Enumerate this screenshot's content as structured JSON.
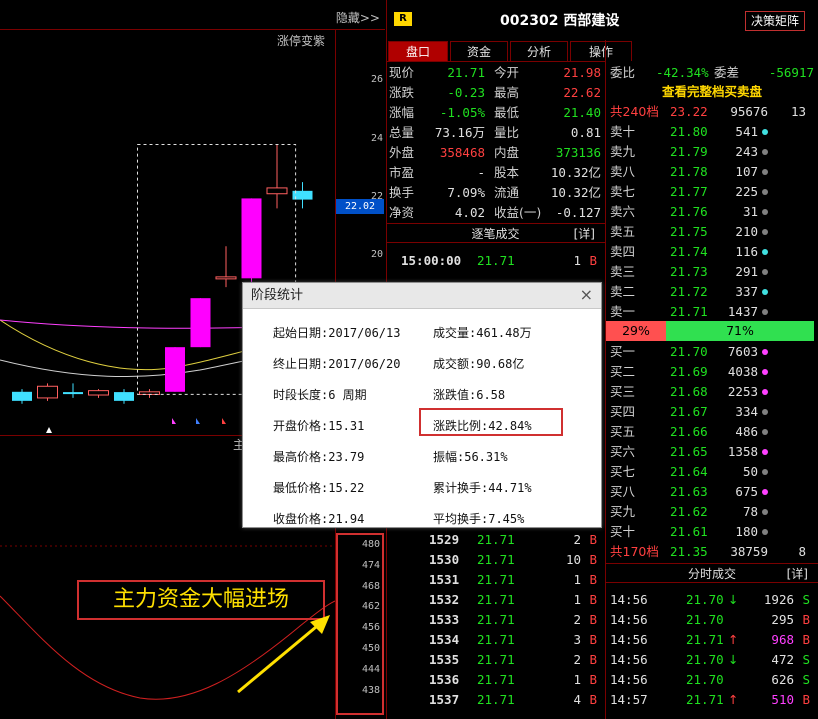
{
  "chart": {
    "hide_label": "隐藏>>",
    "indicator_label": "涨停变紫",
    "current_price_tag": "22.02",
    "y_ticks": [
      "26",
      "24",
      "22",
      "20"
    ],
    "vol_ticks": [
      "480",
      "474",
      "468",
      "462",
      "456",
      "450",
      "444",
      "438"
    ],
    "banner": "主力资金大幅进场",
    "sub_label": "主",
    "candles": [
      {
        "o": 15.31,
        "c": 15.0,
        "h": 15.4,
        "l": 14.9
      },
      {
        "o": 15.1,
        "c": 15.5,
        "h": 15.6,
        "l": 15.0
      },
      {
        "o": 15.3,
        "c": 15.25,
        "h": 15.6,
        "l": 15.1
      },
      {
        "o": 15.2,
        "c": 15.35,
        "h": 15.4,
        "l": 15.1
      },
      {
        "o": 15.3,
        "c": 15.0,
        "h": 15.4,
        "l": 14.9
      },
      {
        "o": 15.22,
        "c": 15.31,
        "h": 15.4,
        "l": 15.1
      },
      {
        "o": 15.31,
        "c": 16.84,
        "h": 16.84,
        "l": 15.31
      },
      {
        "o": 16.84,
        "c": 18.52,
        "h": 18.52,
        "l": 16.84
      },
      {
        "o": 19.25,
        "c": 19.25,
        "h": 20.3,
        "l": 18.9
      },
      {
        "o": 19.2,
        "c": 21.94,
        "h": 21.94,
        "l": 19.0
      },
      {
        "o": 22.1,
        "c": 22.3,
        "h": 23.79,
        "l": 21.6
      },
      {
        "o": 22.2,
        "c": 21.9,
        "h": 22.5,
        "l": 21.6
      }
    ]
  },
  "header": {
    "badge": "R",
    "title": "002302 西部建设",
    "decision_button": "决策矩阵"
  },
  "tabs": [
    "盘口",
    "资金",
    "分析",
    "操作"
  ],
  "quote": {
    "rows": [
      {
        "l1": "现价",
        "v1": "21.71",
        "l2": "今开",
        "v2": "21.98"
      },
      {
        "l1": "涨跌",
        "v1": "-0.23",
        "l2": "最高",
        "v2": "22.62"
      },
      {
        "l1": "涨幅",
        "v1": "-1.05%",
        "l2": "最低",
        "v2": "21.40"
      },
      {
        "l1": "总量",
        "v1": "73.16万",
        "l2": "量比",
        "v2": "0.81"
      },
      {
        "l1": "外盘",
        "v1": "358468",
        "l2": "内盘",
        "v2": "373136"
      },
      {
        "l1": "市盈",
        "v1": "-",
        "l2": "股本",
        "v2": "10.32亿"
      },
      {
        "l1": "换手",
        "v1": "7.09%",
        "l2": "流通",
        "v2": "10.32亿"
      },
      {
        "l1": "净资",
        "v1": "4.02",
        "l2": "收益(一)",
        "v2": "-0.127"
      }
    ]
  },
  "ticks_header": {
    "title": "逐笔成交",
    "detail": "[详]"
  },
  "ticks_top": [
    {
      "time": "15:00:00",
      "price": "21.71",
      "vol": "1",
      "side": "B"
    }
  ],
  "ticks": [
    {
      "time": "1529",
      "price": "21.71",
      "vol": "2",
      "side": "B"
    },
    {
      "time": "1530",
      "price": "21.71",
      "vol": "10",
      "side": "B"
    },
    {
      "time": "1531",
      "price": "21.71",
      "vol": "1",
      "side": "B"
    },
    {
      "time": "1532",
      "price": "21.71",
      "vol": "1",
      "side": "B"
    },
    {
      "time": "1533",
      "price": "21.71",
      "vol": "2",
      "side": "B"
    },
    {
      "time": "1534",
      "price": "21.71",
      "vol": "3",
      "side": "B"
    },
    {
      "time": "1535",
      "price": "21.71",
      "vol": "2",
      "side": "B"
    },
    {
      "time": "1536",
      "price": "21.71",
      "vol": "1",
      "side": "B"
    },
    {
      "time": "1537",
      "price": "21.71",
      "vol": "4",
      "side": "B"
    }
  ],
  "orderbook": {
    "weibi_label": "委比",
    "weibi": "-42.34%",
    "weicha_label": "委差",
    "weicha": "-56917",
    "full_book": "查看完整档买卖盘",
    "sell_total": {
      "label": "共240档",
      "price": "23.22",
      "vol": "95676",
      "n": "13"
    },
    "sells": [
      {
        "label": "卖十",
        "price": "21.80",
        "vol": "541",
        "dot": "#40e0e0"
      },
      {
        "label": "卖九",
        "price": "21.79",
        "vol": "243",
        "dot": "#808080"
      },
      {
        "label": "卖八",
        "price": "21.78",
        "vol": "107",
        "dot": "#808080"
      },
      {
        "label": "卖七",
        "price": "21.77",
        "vol": "225",
        "dot": "#808080"
      },
      {
        "label": "卖六",
        "price": "21.76",
        "vol": "31",
        "dot": "#808080"
      },
      {
        "label": "卖五",
        "price": "21.75",
        "vol": "210",
        "dot": "#808080"
      },
      {
        "label": "卖四",
        "price": "21.74",
        "vol": "116",
        "dot": "#40e0e0"
      },
      {
        "label": "卖三",
        "price": "21.73",
        "vol": "291",
        "dot": "#808080"
      },
      {
        "label": "卖二",
        "price": "21.72",
        "vol": "337",
        "dot": "#40e0e0"
      },
      {
        "label": "卖一",
        "price": "21.71",
        "vol": "1437",
        "dot": "#808080"
      }
    ],
    "ratio_sell": "29%",
    "ratio_buy": "71%",
    "buys": [
      {
        "label": "买一",
        "price": "21.70",
        "vol": "7603",
        "dot": "#ff40ff"
      },
      {
        "label": "买二",
        "price": "21.69",
        "vol": "4038",
        "dot": "#ff40ff"
      },
      {
        "label": "买三",
        "price": "21.68",
        "vol": "2253",
        "dot": "#ff40ff"
      },
      {
        "label": "买四",
        "price": "21.67",
        "vol": "334",
        "dot": "#808080"
      },
      {
        "label": "买五",
        "price": "21.66",
        "vol": "486",
        "dot": "#808080"
      },
      {
        "label": "买六",
        "price": "21.65",
        "vol": "1358",
        "dot": "#ff40ff"
      },
      {
        "label": "买七",
        "price": "21.64",
        "vol": "50",
        "dot": "#808080"
      },
      {
        "label": "买八",
        "price": "21.63",
        "vol": "675",
        "dot": "#ff40ff"
      },
      {
        "label": "买九",
        "price": "21.62",
        "vol": "78",
        "dot": "#808080"
      },
      {
        "label": "买十",
        "price": "21.61",
        "vol": "180",
        "dot": "#808080"
      }
    ],
    "buy_total": {
      "label": "共170档",
      "price": "21.35",
      "vol": "38759",
      "n": "8"
    }
  },
  "timesales_header": {
    "title": "分时成交",
    "detail": "[详]"
  },
  "timesales": [
    {
      "time": "14:56",
      "price": "21.70",
      "arrow": "↓",
      "vol": "1926",
      "side": "S"
    },
    {
      "time": "14:56",
      "price": "21.70",
      "arrow": "",
      "vol": "295",
      "side": "B"
    },
    {
      "time": "14:56",
      "price": "21.71",
      "arrow": "↑",
      "vol": "968",
      "side": "B"
    },
    {
      "time": "14:56",
      "price": "21.70",
      "arrow": "↓",
      "vol": "472",
      "side": "S"
    },
    {
      "time": "14:56",
      "price": "21.70",
      "arrow": "",
      "vol": "626",
      "side": "S"
    },
    {
      "time": "14:57",
      "price": "21.71",
      "arrow": "↑",
      "vol": "510",
      "side": "B"
    }
  ],
  "dialog": {
    "title": "阶段统计",
    "close": "×",
    "left": [
      "起始日期:2017/06/13",
      "终止日期:2017/06/20",
      "时段长度:6 周期",
      "开盘价格:15.31",
      "最高价格:23.79",
      "最低价格:15.22",
      "收盘价格:21.94"
    ],
    "right": [
      "成交量:461.48万",
      "成交额:90.68亿",
      "涨跌值:6.58",
      "涨跌比例:42.84%",
      "振幅:56.31%",
      "累计换手:44.71%",
      "平均换手:7.45%"
    ]
  }
}
